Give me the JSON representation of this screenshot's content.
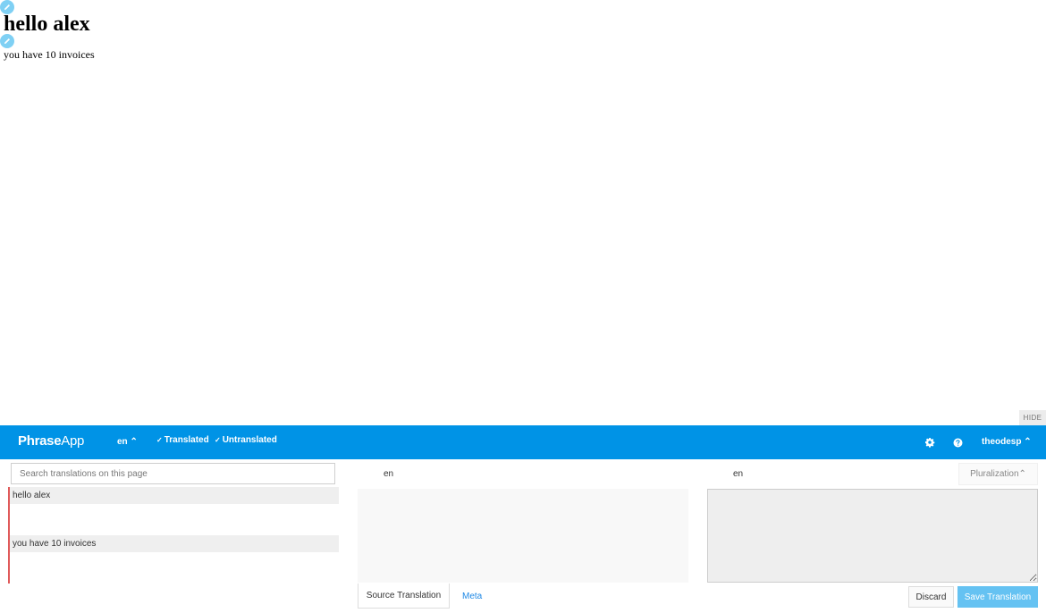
{
  "page": {
    "heading": "hello alex",
    "text": "you have 10 invoices"
  },
  "editor": {
    "hide_label": "HIDE",
    "brand": {
      "bold": "Phrase",
      "regular": "App"
    },
    "locale_label": "en",
    "filters": {
      "translated": "Translated",
      "untranslated": "Untranslated"
    },
    "username": "theodesp",
    "search": {
      "placeholder": "Search translations on this page",
      "value": ""
    },
    "keys": [
      {
        "label": "hello alex"
      },
      {
        "label": "you have 10 invoices"
      }
    ],
    "source_locale": "en",
    "target_locale": "en",
    "pluralization_label": "Pluralization",
    "tabs": {
      "source_translation": "Source Translation",
      "meta": "Meta"
    },
    "buttons": {
      "discard": "Discard",
      "save": "Save Translation"
    },
    "icons": {
      "edit": "pencil-icon",
      "settings": "gear-icon",
      "help": "question-icon",
      "dropdown": "chevron-up-icon",
      "check": "check-icon"
    },
    "colors": {
      "topbar": "#0093e6",
      "accent_border": "#e05a5a",
      "save_button": "#65c2f2",
      "link": "#1e88e5",
      "edit_marker": "#7fd0f4"
    }
  }
}
